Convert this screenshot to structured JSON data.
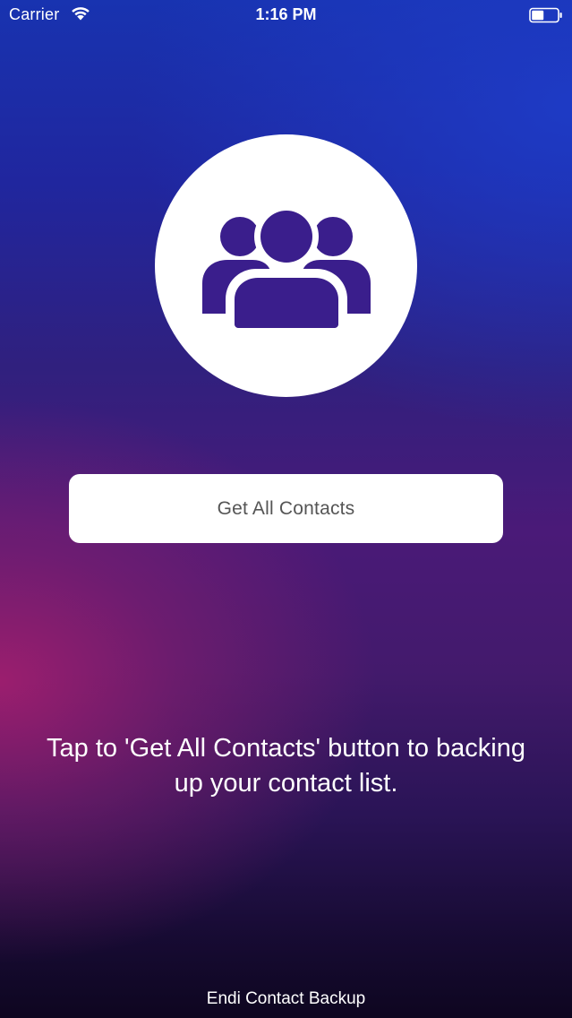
{
  "status_bar": {
    "carrier": "Carrier",
    "time": "1:16 PM",
    "wifi_icon": "wifi-icon",
    "battery_icon": "battery-icon"
  },
  "hero": {
    "icon": "contacts-group-icon",
    "icon_color": "#3a1e8c"
  },
  "main": {
    "get_contacts_label": "Get All Contacts",
    "instruction": "Tap to 'Get All Contacts' button to backing up your contact list."
  },
  "footer": {
    "app_name": "Endi Contact Backup"
  },
  "colors": {
    "gradient_top": "#1833b0",
    "gradient_mid": "#4a1a78",
    "gradient_pink": "#a01e6e",
    "gradient_bottom": "#0e0620",
    "button_bg": "#ffffff",
    "button_text": "#555555"
  }
}
